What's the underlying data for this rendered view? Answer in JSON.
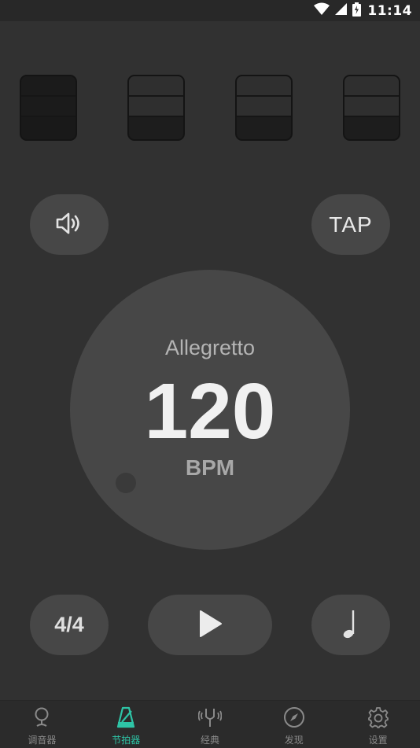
{
  "status": {
    "time": "11:14",
    "icons": [
      "wifi-icon",
      "signal-icon",
      "battery-icon"
    ]
  },
  "beats": [
    {
      "index": 1,
      "accent": "active"
    },
    {
      "index": 2,
      "accent": "normal"
    },
    {
      "index": 3,
      "accent": "normal"
    },
    {
      "index": 4,
      "accent": "normal"
    }
  ],
  "controls": {
    "tap_label": "TAP",
    "time_signature": "4/4"
  },
  "dial": {
    "tempo_name": "Allegretto",
    "bpm": "120",
    "unit": "BPM"
  },
  "nav": {
    "items": [
      {
        "label": "调音器",
        "icon": "tuner-icon",
        "active": false
      },
      {
        "label": "节拍器",
        "icon": "metronome-icon",
        "active": true
      },
      {
        "label": "经典",
        "icon": "tuning-fork-icon",
        "active": false
      },
      {
        "label": "发现",
        "icon": "compass-icon",
        "active": false
      },
      {
        "label": "设置",
        "icon": "gear-icon",
        "active": false
      }
    ]
  },
  "colors": {
    "accent": "#2ec4a6",
    "background": "#313131",
    "surface": "#474747"
  }
}
